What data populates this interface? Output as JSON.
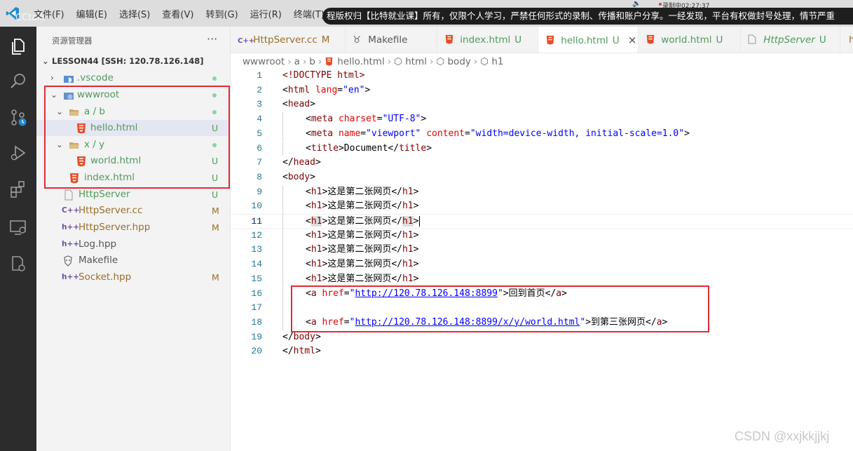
{
  "titlebar": {
    "menu": [
      "文件(F)",
      "编辑(E)",
      "选择(S)",
      "查看(V)",
      "转到(G)",
      "运行(R)",
      "终端(T)"
    ],
    "overlay_logo": "CCtalk",
    "notice": "程版权归【比特就业课】所有，仅限个人学习，严禁任何形式的录制、传播和账户分享。一经发现，平台有权做封号处理，情节严重",
    "recording": "录制中02:27:37"
  },
  "sidebar": {
    "title": "资源管理器",
    "more": "···",
    "project": "LESSON44 [SSH: 120.78.126.148]",
    "items": [
      {
        "label": ".vscode",
        "status": ""
      },
      {
        "label": "wwwroot",
        "status": ""
      },
      {
        "label": "a / b",
        "status": ""
      },
      {
        "label": "hello.html",
        "status": "U"
      },
      {
        "label": "x / y",
        "status": ""
      },
      {
        "label": "world.html",
        "status": "U"
      },
      {
        "label": "index.html",
        "status": "U"
      },
      {
        "label": "HttpServer",
        "status": "U"
      },
      {
        "label": "HttpServer.cc",
        "status": "M"
      },
      {
        "label": "HttpServer.hpp",
        "status": "M"
      },
      {
        "label": "Log.hpp",
        "status": ""
      },
      {
        "label": "Makefile",
        "status": ""
      },
      {
        "label": "Socket.hpp",
        "status": "M"
      }
    ]
  },
  "tabs": [
    {
      "label": "HttpServer.cc",
      "status": "M"
    },
    {
      "label": "Makefile",
      "status": ""
    },
    {
      "label": "index.html",
      "status": "U"
    },
    {
      "label": "hello.html",
      "status": "U",
      "close": "×"
    },
    {
      "label": "world.html",
      "status": "U"
    },
    {
      "label": "HttpServer",
      "status": "U"
    },
    {
      "label": "h",
      "status": ""
    }
  ],
  "breadcrumb": [
    "wwwroot",
    "a",
    "b",
    "hello.html",
    "html",
    "body",
    "h1"
  ],
  "editor": {
    "line_numbers": [
      "1",
      "2",
      "3",
      "4",
      "5",
      "6",
      "7",
      "8",
      "9",
      "10",
      "11",
      "12",
      "13",
      "14",
      "15",
      "16",
      "17",
      "18",
      "19",
      "20"
    ],
    "doctype": "<!DOCTYPE html>",
    "h1_text": "这是第二张网页",
    "lang": "\"en\"",
    "charset": "\"UTF-8\"",
    "viewport_name": "\"viewport\"",
    "viewport_content": "\"width=device-width, initial-scale=1.0\"",
    "title_text": "Document",
    "link1_href": "http://120.78.126.148:8899",
    "link1_text": "回到首页",
    "link2_href": "http://120.78.126.148:8899/x/y/world.html",
    "link2_text": "到第三张网页"
  },
  "watermark": "CSDN @xxjkkjjkj",
  "colors": {
    "activitybar": "#2c2c2c",
    "sidebar": "#f3f3f3",
    "highlight_box": "#e02b36",
    "untracked": "#4e9a5d",
    "modified": "#9b6d2b",
    "tag": "#800000",
    "attr": "#e50000",
    "value": "#0000ff"
  }
}
